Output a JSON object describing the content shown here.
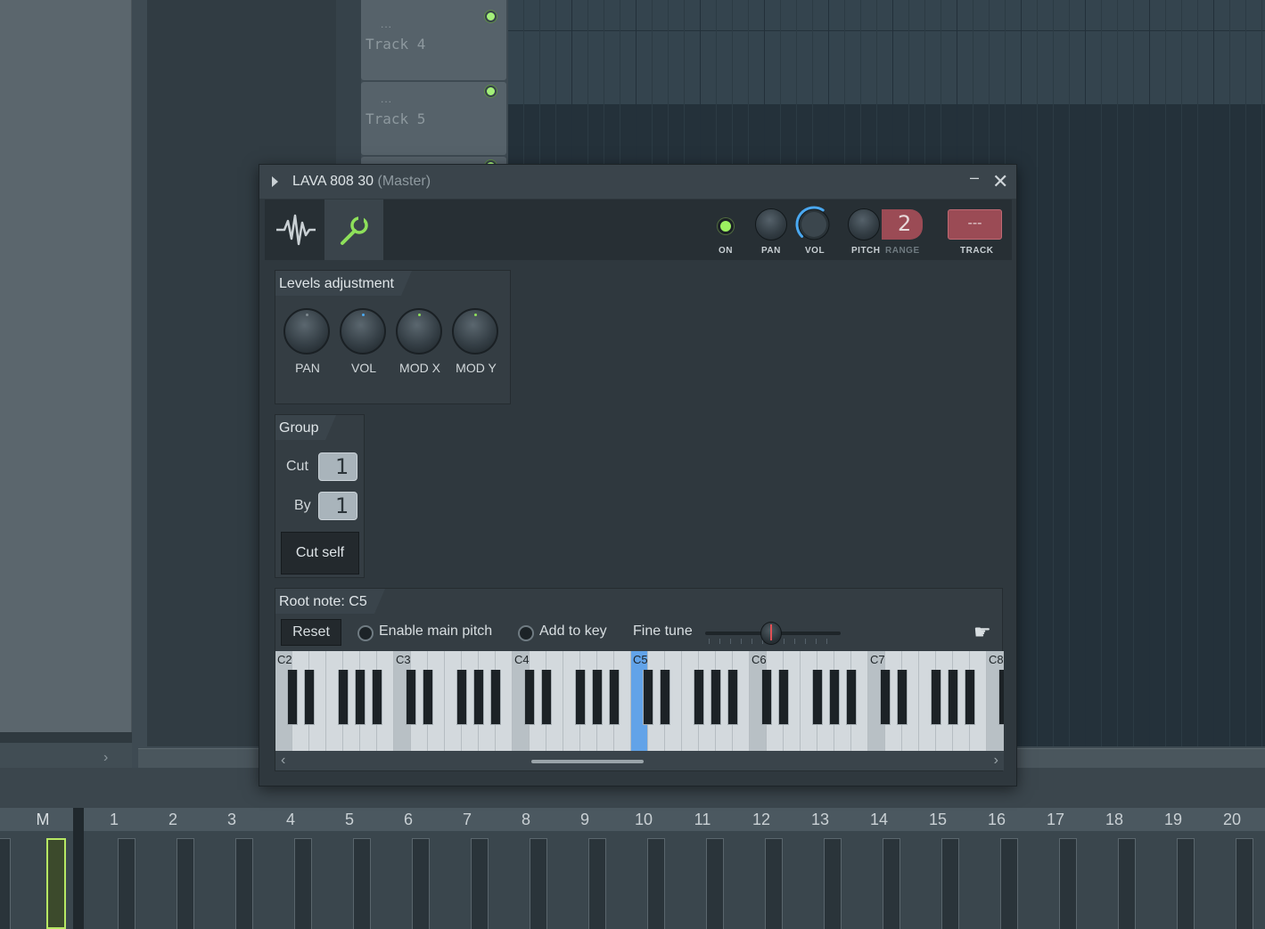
{
  "tracks": [
    {
      "name": "Track 4",
      "dots": "..."
    },
    {
      "name": "Track 5",
      "dots": "..."
    }
  ],
  "sidebar_arrow": "›",
  "window": {
    "title": "LAVA 808 30",
    "subtitle": "(Master)",
    "minimize": "–",
    "close": "✕"
  },
  "toolbar": {
    "on_label": "ON",
    "pan_label": "PAN",
    "vol_label": "VOL",
    "pitch_label": "PITCH",
    "range_label": "RANGE",
    "range_value": "2",
    "track_label": "TRACK",
    "track_value": "---",
    "vol_level": 0.62
  },
  "levels": {
    "title": "Levels adjustment",
    "knobs": [
      "PAN",
      "VOL",
      "MOD X",
      "MOD Y"
    ]
  },
  "group": {
    "title": "Group",
    "cut_label": "Cut",
    "cut_value": "1",
    "by_label": "By",
    "by_value": "1",
    "cut_self": "Cut self"
  },
  "root": {
    "title": "Root note: C5",
    "reset": "Reset",
    "enable_main_pitch": "Enable main pitch",
    "add_to_key": "Add to key",
    "fine_tune": "Fine tune",
    "octaves": [
      "C2",
      "C3",
      "C4",
      "C5",
      "C6",
      "C7",
      "C8"
    ],
    "selected_note": "C5",
    "scroll_left": "‹",
    "scroll_right": "›"
  },
  "mixer": {
    "master_label": "M",
    "channels": [
      "1",
      "2",
      "3",
      "4",
      "5",
      "6",
      "7",
      "8",
      "9",
      "10",
      "11",
      "12",
      "13",
      "14",
      "15",
      "16",
      "17",
      "18",
      "19",
      "20"
    ]
  },
  "colors": {
    "led_green": "#9cf060",
    "vol_ring": "#4aa8f0",
    "track_red": "#9b4b55",
    "selected_key": "#62a3e8"
  }
}
